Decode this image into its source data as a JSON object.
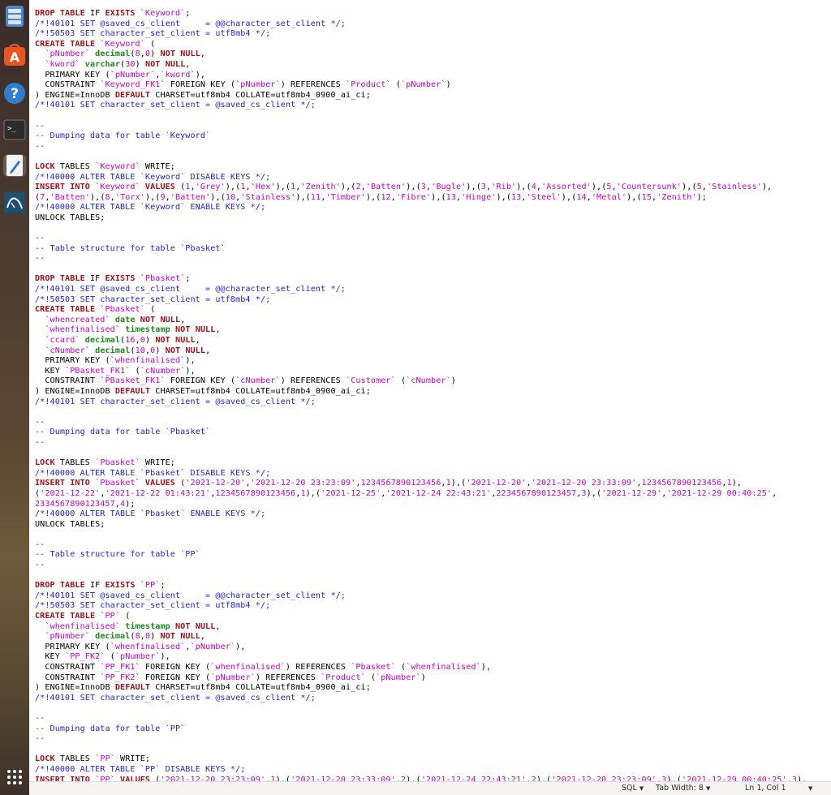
{
  "dock": {
    "items": [
      {
        "name": "files-icon"
      },
      {
        "name": "software-center-icon"
      },
      {
        "name": "help-icon"
      },
      {
        "name": "terminal-icon"
      },
      {
        "name": "text-editor-icon"
      },
      {
        "name": "mysql-workbench-icon"
      },
      {
        "name": "show-apps-icon"
      }
    ]
  },
  "editor": {
    "language": "SQL",
    "lines": [
      "<span class='k'>DROP TABLE</span> IF <span class='k'>EXISTS</span> <span class='s'>`Keyword`</span>;",
      "<span class='c'>/*!40101 SET @saved_cs_client     = @@character_set_client */;</span>",
      "<span class='c'>/*!50503 SET character_set_client = utf8mb4 */;</span>",
      "<span class='k'>CREATE TABLE</span> <span class='s'>`Keyword`</span> (",
      "  <span class='s'>`pNumber`</span> <span class='t'>decimal</span>(<span class='s'>8</span>,<span class='s'>0</span>) <span class='k'>NOT NULL</span>,",
      "  <span class='s'>`kword`</span> <span class='t'>varchar</span>(<span class='s'>30</span>) <span class='k'>NOT NULL</span>,",
      "  PRIMARY KEY (<span class='s'>`pNumber`</span>,<span class='s'>`kword`</span>),",
      "  CONSTRAINT <span class='s'>`Keyword_FK1`</span> FOREIGN KEY (<span class='s'>`pNumber`</span>) REFERENCES <span class='s'>`Product`</span> (<span class='s'>`pNumber`</span>)",
      ") ENGINE=InnoDB <span class='k'>DEFAULT</span> CHARSET=utf8mb4 COLLATE=utf8mb4_0900_ai_ci;",
      "<span class='c'>/*!40101 SET character_set_client = @saved_cs_client */;</span>",
      "",
      "<span class='c'>--</span>",
      "<span class='c'>-- Dumping data for table `Keyword`</span>",
      "<span class='c'>--</span>",
      "",
      "<span class='k'>LOCK</span> TABLES <span class='s'>`Keyword`</span> WRITE;",
      "<span class='c'>/*!40000 ALTER TABLE `Keyword` DISABLE KEYS */;</span>",
      "<span class='k'>INSERT INTO</span> <span class='s'>`Keyword`</span> <span class='k'>VALUES</span> (<span class='s'>1</span>,<span class='s'>'Grey'</span>),(<span class='s'>1</span>,<span class='s'>'Hex'</span>),(<span class='s'>1</span>,<span class='s'>'Zenith'</span>),(<span class='s'>2</span>,<span class='s'>'Batten'</span>),(<span class='s'>3</span>,<span class='s'>'Bugle'</span>),(<span class='s'>3</span>,<span class='s'>'Rib'</span>),(<span class='s'>4</span>,<span class='s'>'Assorted'</span>),(<span class='s'>5</span>,<span class='s'>'Countersunk'</span>),(<span class='s'>5</span>,<span class='s'>'Stainless'</span>),",
      "(<span class='s'>7</span>,<span class='s'>'Batten'</span>),(<span class='s'>8</span>,<span class='s'>'Torx'</span>),(<span class='s'>9</span>,<span class='s'>'Batten'</span>),(<span class='s'>10</span>,<span class='s'>'Stainless'</span>),(<span class='s'>11</span>,<span class='s'>'Timber'</span>),(<span class='s'>12</span>,<span class='s'>'Fibre'</span>),(<span class='s'>13</span>,<span class='s'>'Hinge'</span>),(<span class='s'>13</span>,<span class='s'>'Steel'</span>),(<span class='s'>14</span>,<span class='s'>'Metal'</span>),(<span class='s'>15</span>,<span class='s'>'Zenith'</span>);",
      "<span class='c'>/*!40000 ALTER TABLE `Keyword` ENABLE KEYS */;</span>",
      "UNLOCK TABLES;",
      "",
      "<span class='c'>--</span>",
      "<span class='c'>-- Table structure for table `Pbasket`</span>",
      "<span class='c'>--</span>",
      "",
      "<span class='k'>DROP TABLE</span> IF <span class='k'>EXISTS</span> <span class='s'>`Pbasket`</span>;",
      "<span class='c'>/*!40101 SET @saved_cs_client     = @@character_set_client */;</span>",
      "<span class='c'>/*!50503 SET character_set_client = utf8mb4 */;</span>",
      "<span class='k'>CREATE TABLE</span> <span class='s'>`Pbasket`</span> (",
      "  <span class='s'>`whencreated`</span> <span class='t'>date</span> <span class='k'>NOT NULL</span>,",
      "  <span class='s'>`whenfinalised`</span> <span class='t'>timestamp</span> <span class='k'>NOT NULL</span>,",
      "  <span class='s'>`ccard`</span> <span class='t'>decimal</span>(<span class='s'>16</span>,<span class='s'>0</span>) <span class='k'>NOT NULL</span>,",
      "  <span class='s'>`cNumber`</span> <span class='t'>decimal</span>(<span class='s'>10</span>,<span class='s'>0</span>) <span class='k'>NOT NULL</span>,",
      "  PRIMARY KEY (<span class='s'>`whenfinalised`</span>),",
      "  KEY <span class='s'>`PBasket_FK1`</span> (<span class='s'>`cNumber`</span>),",
      "  CONSTRAINT <span class='s'>`PBasket_FK1`</span> FOREIGN KEY (<span class='s'>`cNumber`</span>) REFERENCES <span class='s'>`Customer`</span> (<span class='s'>`cNumber`</span>)",
      ") ENGINE=InnoDB <span class='k'>DEFAULT</span> CHARSET=utf8mb4 COLLATE=utf8mb4_0900_ai_ci;",
      "<span class='c'>/*!40101 SET character_set_client = @saved_cs_client */;</span>",
      "",
      "<span class='c'>--</span>",
      "<span class='c'>-- Dumping data for table `Pbasket`</span>",
      "<span class='c'>--</span>",
      "",
      "<span class='k'>LOCK</span> TABLES <span class='s'>`Pbasket`</span> WRITE;",
      "<span class='c'>/*!40000 ALTER TABLE `Pbasket` DISABLE KEYS */;</span>",
      "<span class='k'>INSERT INTO</span> <span class='s'>`Pbasket`</span> <span class='k'>VALUES</span> (<span class='s'>'2021-12-20'</span>,<span class='s'>'2021-12-20 23:23:09'</span>,<span class='s'>1234567890123456</span>,<span class='s'>1</span>),(<span class='s'>'2021-12-20'</span>,<span class='s'>'2021-12-20 23:33:09'</span>,<span class='s'>1234567890123456</span>,<span class='s'>1</span>),",
      "(<span class='s'>'2021-12-22'</span>,<span class='s'>'2021-12-22 01:43:21'</span>,<span class='s'>1234567890123456</span>,<span class='s'>1</span>),(<span class='s'>'2021-12-25'</span>,<span class='s'>'2021-12-24 22:43:21'</span>,<span class='s'>2234567890123457</span>,<span class='s'>3</span>),(<span class='s'>'2021-12-29'</span>,<span class='s'>'2021-12-29 00:40:25'</span>,",
      "<span class='s'>2334567890123457</span>,<span class='s'>4</span>);",
      "<span class='c'>/*!40000 ALTER TABLE `Pbasket` ENABLE KEYS */;</span>",
      "UNLOCK TABLES;",
      "",
      "<span class='c'>--</span>",
      "<span class='c'>-- Table structure for table `PP`</span>",
      "<span class='c'>--</span>",
      "",
      "<span class='k'>DROP TABLE</span> IF <span class='k'>EXISTS</span> <span class='s'>`PP`</span>;",
      "<span class='c'>/*!40101 SET @saved_cs_client     = @@character_set_client */;</span>",
      "<span class='c'>/*!50503 SET character_set_client = utf8mb4 */;</span>",
      "<span class='k'>CREATE TABLE</span> <span class='s'>`PP`</span> (",
      "  <span class='s'>`whenfinalised`</span> <span class='t'>timestamp</span> <span class='k'>NOT NULL</span>,",
      "  <span class='s'>`pNumber`</span> <span class='t'>decimal</span>(<span class='s'>8</span>,<span class='s'>0</span>) <span class='k'>NOT NULL</span>,",
      "  PRIMARY KEY (<span class='s'>`whenfinalised`</span>,<span class='s'>`pNumber`</span>),",
      "  KEY <span class='s'>`PP_FK2`</span> (<span class='s'>`pNumber`</span>),",
      "  CONSTRAINT <span class='s'>`PP_FK1`</span> FOREIGN KEY (<span class='s'>`whenfinalised`</span>) REFERENCES <span class='s'>`Pbasket`</span> (<span class='s'>`whenfinalised`</span>),",
      "  CONSTRAINT <span class='s'>`PP_FK2`</span> FOREIGN KEY (<span class='s'>`pNumber`</span>) REFERENCES <span class='s'>`Product`</span> (<span class='s'>`pNumber`</span>)",
      ") ENGINE=InnoDB <span class='k'>DEFAULT</span> CHARSET=utf8mb4 COLLATE=utf8mb4_0900_ai_ci;",
      "<span class='c'>/*!40101 SET character_set_client = @saved_cs_client */;</span>",
      "",
      "<span class='c'>--</span>",
      "<span class='c'>-- Dumping data for table `PP`</span>",
      "<span class='c'>--</span>",
      "",
      "<span class='k'>LOCK</span> TABLES <span class='s'>`PP`</span> WRITE;",
      "<span class='c'>/*!40000 ALTER TABLE `PP` DISABLE KEYS */;</span>",
      "<span class='k'>INSERT INTO</span> <span class='s'>`PP`</span> <span class='k'>VALUES</span> (<span class='s'>'2021-12-20 23:23:09'</span>,<span class='s'>1</span>),(<span class='s'>'2021-12-20 23:33:09'</span>,<span class='s'>2</span>),(<span class='s'>'2021-12-24 22:43:21'</span>,<span class='s'>2</span>),(<span class='s'>'2021-12-20 23:23:09'</span>,<span class='s'>3</span>),(<span class='s'>'2021-12-29 00:40:25'</span>,<span class='s'>3</span>),"
    ]
  },
  "statusbar": {
    "language": "SQL",
    "tab_width": "Tab Width: 8",
    "position": "Ln 1, Col 1"
  }
}
